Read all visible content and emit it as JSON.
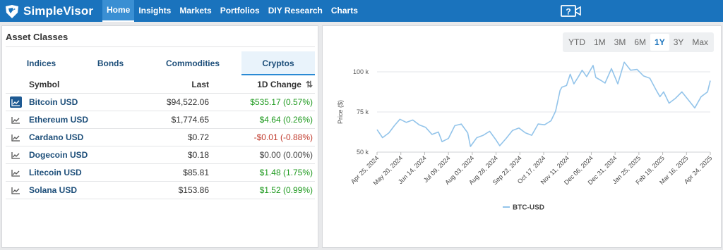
{
  "app": {
    "name": "SimpleVisor"
  },
  "nav": {
    "items": [
      {
        "label": "Home",
        "active": true
      },
      {
        "label": "Insights"
      },
      {
        "label": "Markets"
      },
      {
        "label": "Portfolios"
      },
      {
        "label": "DIY Research"
      },
      {
        "label": "Charts"
      }
    ]
  },
  "colors": {
    "brand": "#1a73bd",
    "positive": "#1f9a1f",
    "negative": "#c0392b",
    "series": "#93c4ea"
  },
  "asset_panel": {
    "title": "Asset Classes",
    "tabs": [
      {
        "label": "Indices"
      },
      {
        "label": "Bonds"
      },
      {
        "label": "Commodities"
      },
      {
        "label": "Cryptos",
        "active": true
      }
    ],
    "columns": {
      "symbol": "Symbol",
      "last": "Last",
      "change": "1D Change"
    },
    "rows": [
      {
        "symbol": "Bitcoin USD",
        "last": "$94,522.06",
        "change": "$535.17 (0.57%)",
        "direction": "pos",
        "selected": true
      },
      {
        "symbol": "Ethereum USD",
        "last": "$1,774.65",
        "change": "$4.64 (0.26%)",
        "direction": "pos"
      },
      {
        "symbol": "Cardano USD",
        "last": "$0.72",
        "change": "-$0.01 (-0.88%)",
        "direction": "neg"
      },
      {
        "symbol": "Dogecoin USD",
        "last": "$0.18",
        "change": "$0.00 (0.00%)",
        "direction": "neu"
      },
      {
        "symbol": "Litecoin USD",
        "last": "$85.81",
        "change": "$1.48 (1.75%)",
        "direction": "pos"
      },
      {
        "symbol": "Solana USD",
        "last": "$153.86",
        "change": "$1.52 (0.99%)",
        "direction": "pos"
      }
    ]
  },
  "ranges": [
    {
      "label": "YTD"
    },
    {
      "label": "1M"
    },
    {
      "label": "3M"
    },
    {
      "label": "6M"
    },
    {
      "label": "1Y",
      "active": true
    },
    {
      "label": "3Y"
    },
    {
      "label": "Max"
    }
  ],
  "chart_data": {
    "type": "line",
    "title": "",
    "xlabel": "",
    "ylabel": "Price ($)",
    "ylim": [
      50000,
      100000
    ],
    "yticks": [
      {
        "value": 50000,
        "label": "50 k"
      },
      {
        "value": 75000,
        "label": "75 k"
      },
      {
        "value": 100000,
        "label": "100 k"
      }
    ],
    "xticks": [
      "Apr 25, 2024",
      "May 20, 2024",
      "Jun 14, 2024",
      "Jul 09, 2024",
      "Aug 03, 2024",
      "Aug 28, 2024",
      "Sep 22, 2024",
      "Oct 17, 2024",
      "Nov 11, 2024",
      "Dec 06, 2024",
      "Dec 31, 2024",
      "Jan 25, 2025",
      "Feb 19, 2025",
      "Mar 16, 2025",
      "Apr 24, 2025"
    ],
    "grid": true,
    "legend": "bottom-center",
    "series": [
      {
        "name": "BTC-USD",
        "x": [
          "2024-04-25",
          "2024-05-01",
          "2024-05-08",
          "2024-05-14",
          "2024-05-20",
          "2024-05-27",
          "2024-06-03",
          "2024-06-10",
          "2024-06-17",
          "2024-06-24",
          "2024-07-01",
          "2024-07-05",
          "2024-07-12",
          "2024-07-19",
          "2024-07-26",
          "2024-08-02",
          "2024-08-05",
          "2024-08-12",
          "2024-08-19",
          "2024-08-26",
          "2024-09-02",
          "2024-09-06",
          "2024-09-13",
          "2024-09-20",
          "2024-09-27",
          "2024-10-04",
          "2024-10-11",
          "2024-10-18",
          "2024-10-25",
          "2024-11-01",
          "2024-11-06",
          "2024-11-11",
          "2024-11-13",
          "2024-11-18",
          "2024-11-22",
          "2024-11-26",
          "2024-12-01",
          "2024-12-05",
          "2024-12-10",
          "2024-12-17",
          "2024-12-20",
          "2024-12-26",
          "2024-12-30",
          "2025-01-06",
          "2025-01-13",
          "2025-01-20",
          "2025-01-27",
          "2025-02-03",
          "2025-02-10",
          "2025-02-17",
          "2025-02-24",
          "2025-02-28",
          "2025-03-04",
          "2025-03-10",
          "2025-03-17",
          "2025-03-24",
          "2025-03-31",
          "2025-04-07",
          "2025-04-14",
          "2025-04-21",
          "2025-04-24"
        ],
        "y": [
          64000,
          59000,
          62000,
          66500,
          70500,
          68500,
          70000,
          67000,
          65500,
          61000,
          62500,
          56500,
          58500,
          66500,
          67500,
          62000,
          53500,
          59000,
          60500,
          63000,
          57500,
          54000,
          58500,
          63500,
          65000,
          62000,
          60500,
          67500,
          67000,
          69500,
          75500,
          88500,
          90500,
          91500,
          98500,
          92500,
          97000,
          101000,
          97000,
          104000,
          96500,
          94500,
          93000,
          102000,
          92500,
          106000,
          101000,
          101500,
          97500,
          96000,
          88500,
          84500,
          87500,
          80500,
          83500,
          87500,
          82500,
          77500,
          84500,
          87500,
          94500
        ]
      }
    ]
  }
}
